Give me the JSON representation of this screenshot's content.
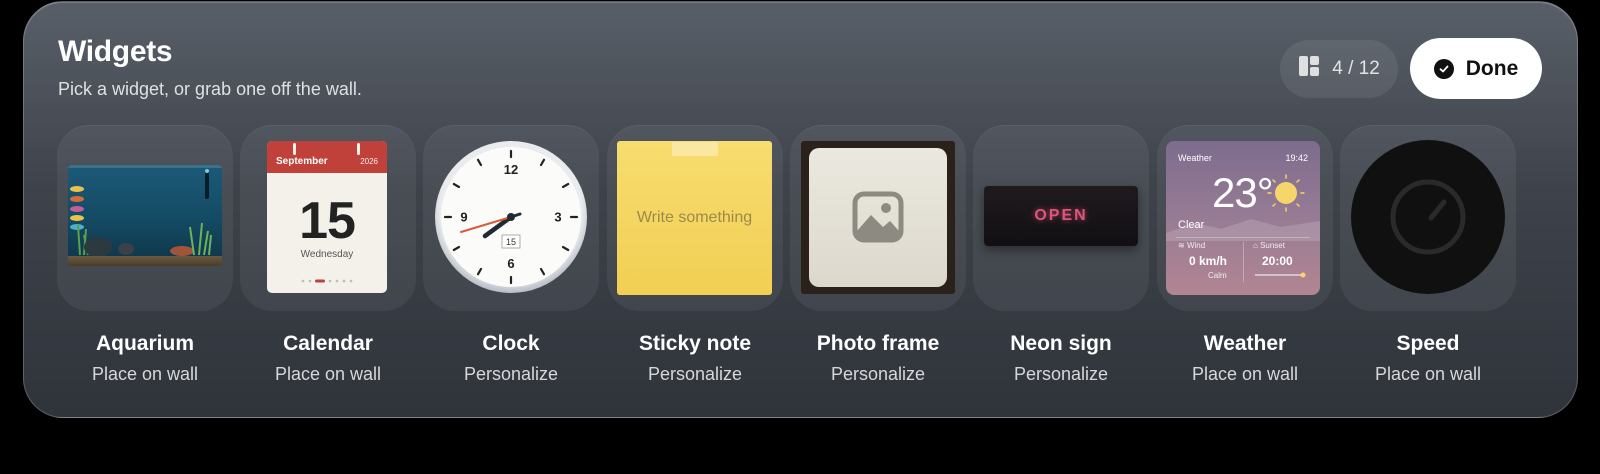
{
  "header": {
    "title": "Widgets",
    "subtitle": "Pick a widget, or grab one off the wall.",
    "counter": "4 / 12",
    "done_label": "Done"
  },
  "widgets": [
    {
      "name": "Aquarium",
      "action": "Place on wall",
      "preview_icon": "aquarium-icon"
    },
    {
      "name": "Calendar",
      "action": "Place on wall",
      "preview": {
        "month": "September",
        "year": "2026",
        "day": "15",
        "weekday": "Wednesday"
      }
    },
    {
      "name": "Clock",
      "action": "Personalize",
      "preview": {
        "numerals": [
          "12",
          "3",
          "6",
          "9"
        ],
        "date": "15"
      }
    },
    {
      "name": "Sticky note",
      "action": "Personalize",
      "preview": {
        "placeholder": "Write something"
      }
    },
    {
      "name": "Photo frame",
      "action": "Personalize",
      "preview_icon": "image-icon"
    },
    {
      "name": "Neon sign",
      "action": "Personalize",
      "preview": {
        "text": "OPEN"
      }
    },
    {
      "name": "Weather",
      "action": "Place on wall",
      "preview": {
        "label": "Weather",
        "time": "19:42",
        "temp": "23°",
        "condition": "Clear",
        "wind_label": "Wind",
        "wind_value": "0 km/h",
        "wind_note": "Calm",
        "sunset_label": "Sunset",
        "sunset_value": "20:00"
      }
    },
    {
      "name": "Speed",
      "action": "Place on wall",
      "preview_icon": "gauge-icon"
    }
  ],
  "colors": {
    "accent_calendar": "#c0403a",
    "sticky": "#f4d35e",
    "neon": "#e0547b",
    "done_bg": "#ffffff"
  }
}
